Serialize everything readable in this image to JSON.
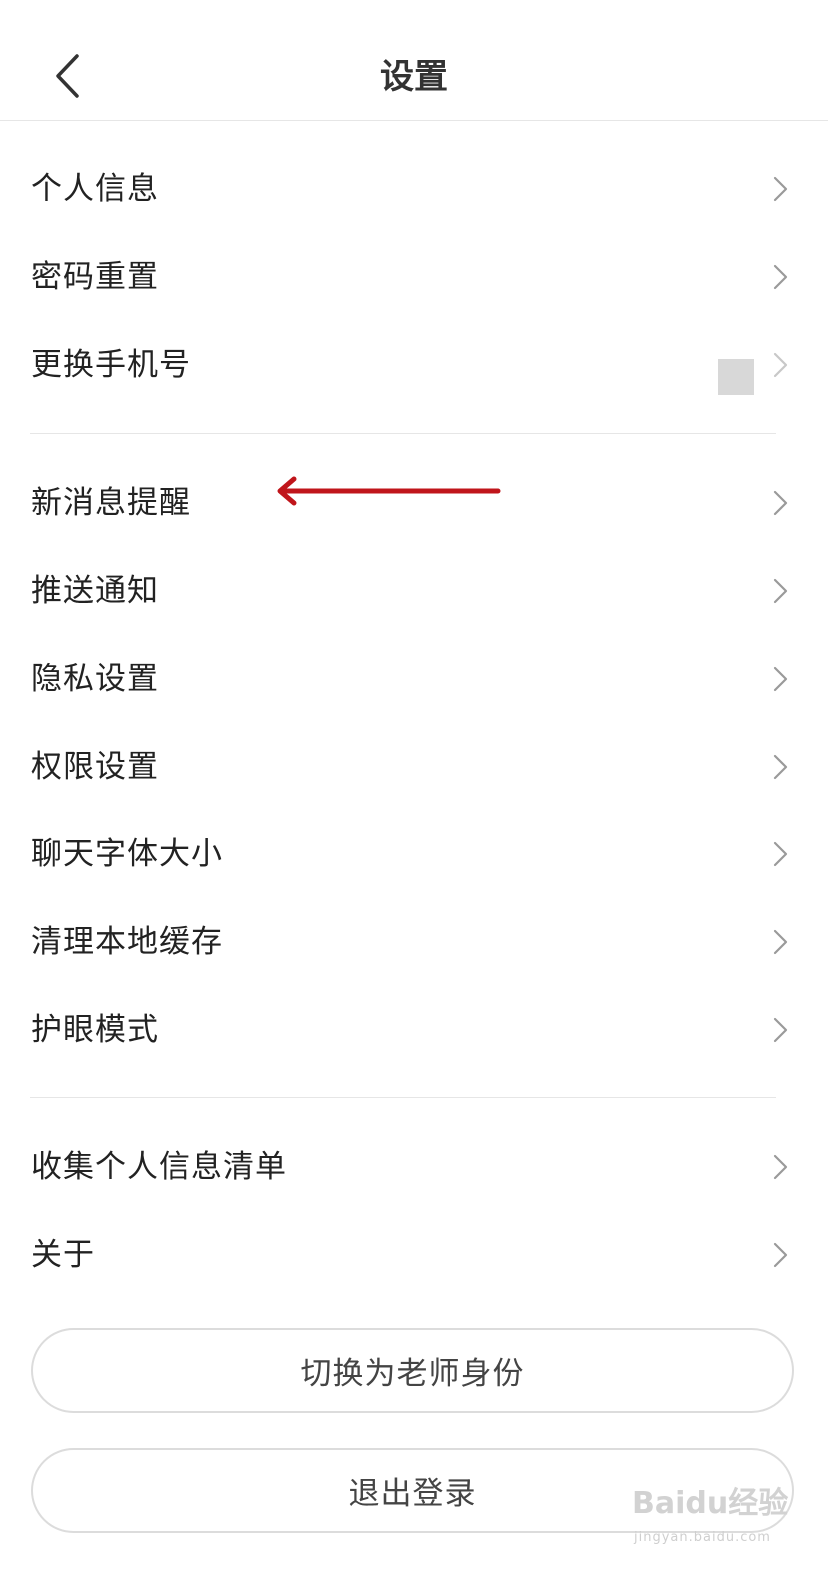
{
  "header": {
    "title": "设置",
    "back_icon": "chevron-left-icon"
  },
  "groups": [
    {
      "items": [
        {
          "label": "个人信息"
        },
        {
          "label": "密码重置"
        },
        {
          "label": "更换手机号"
        }
      ]
    },
    {
      "items": [
        {
          "label": "新消息提醒"
        },
        {
          "label": "推送通知"
        },
        {
          "label": "隐私设置"
        },
        {
          "label": "权限设置"
        },
        {
          "label": "聊天字体大小"
        },
        {
          "label": "清理本地缓存"
        },
        {
          "label": "护眼模式"
        }
      ]
    },
    {
      "items": [
        {
          "label": "收集个人信息清单"
        },
        {
          "label": "关于"
        }
      ]
    }
  ],
  "buttons": {
    "switch_role": "切换为老师身份",
    "logout": "退出登录"
  },
  "annotation": {
    "arrow_color": "#c0151b",
    "arrow_icon": "arrow-left-icon"
  },
  "watermark": {
    "brand": "Baidu经验",
    "url": "jingyan.baidu.com"
  },
  "colors": {
    "divider": "#e6e6e6",
    "chevron": "#9a9a9a",
    "text": "#222222"
  }
}
